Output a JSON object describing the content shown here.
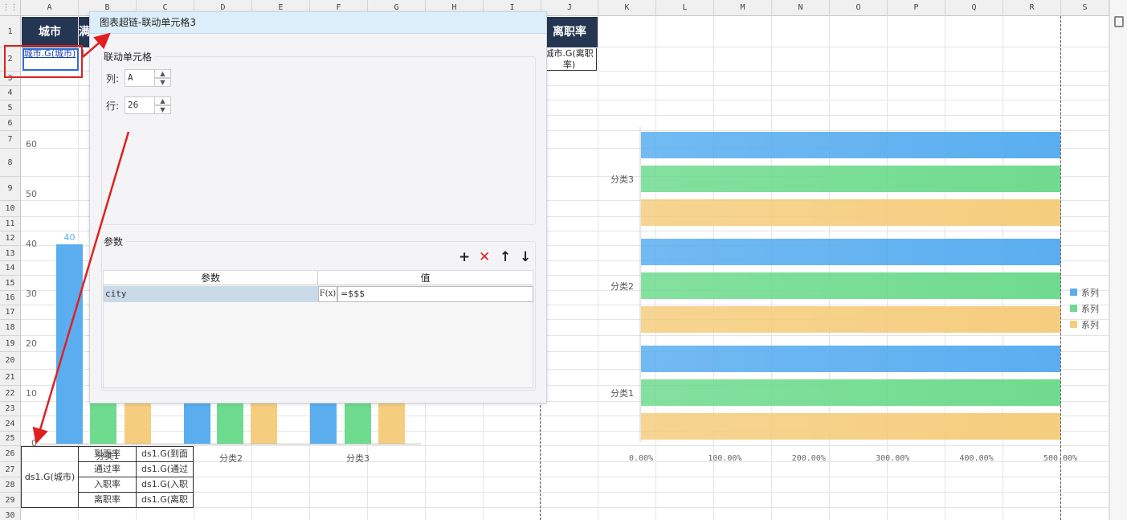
{
  "sheet": {
    "corner": "⋮⋮",
    "columns": [
      "A",
      "B",
      "C",
      "D",
      "E",
      "F",
      "G",
      "H",
      "I",
      "J",
      "K",
      "L",
      "M",
      "N",
      "O",
      "P",
      "Q",
      "R",
      "S"
    ],
    "rows": [
      "1",
      "2",
      "3",
      "4",
      "5",
      "6",
      "7",
      "8",
      "9",
      "10",
      "11",
      "12",
      "13",
      "14",
      "15",
      "16",
      "17",
      "18",
      "19",
      "20",
      "21",
      "22",
      "23",
      "24",
      "25",
      "26",
      "27",
      "28",
      "29",
      "30"
    ],
    "header_city": "城市",
    "header_b_partial": "满",
    "header_leave": "离职率",
    "cell_a2": "城市.G(城市)",
    "cell_j2": "城市.G(离职率)",
    "cell_b2_partial": "1"
  },
  "dialog": {
    "title": "图表超链-联动单元格3",
    "linked_section_title": "联动单元格",
    "col_label": "列:",
    "col_value": "A",
    "row_label": "行:",
    "row_value": "26",
    "param_section_title": "参数",
    "toolbar": {
      "add": "+",
      "delete": "✕",
      "up": "↑",
      "down": "↓"
    },
    "table_headers": {
      "param": "参数",
      "value": "值"
    },
    "rows": [
      {
        "param": "city",
        "fx": "F(x)",
        "value": "=$$$"
      }
    ]
  },
  "left_chart": {
    "y_ticks": [
      "60",
      "50",
      "40",
      "30",
      "20",
      "10",
      "0"
    ],
    "bar_label": "40",
    "categories_visible": [
      "分类2",
      "分类3"
    ]
  },
  "bottom_table": {
    "group": "ds1.G(城市)",
    "labels": [
      "到面率",
      "通过率",
      "入职率",
      "离职率"
    ],
    "label_overlap": "分类1",
    "values": [
      "ds1.G(到面",
      "ds1.G(通过",
      "ds1.G(入职",
      "ds1.G(离职"
    ]
  },
  "chart_data": {
    "type": "bar",
    "orientation": "horizontal",
    "categories": [
      "分类3",
      "分类2",
      "分类1"
    ],
    "x_ticks": [
      "0.00%",
      "100.00%",
      "200.00%",
      "300.00%",
      "400.00%",
      "500.00%"
    ],
    "xlim": [
      0,
      500
    ],
    "series": [
      {
        "name": "系列",
        "values": [
          500,
          500,
          500
        ],
        "color": "#5aaef0"
      },
      {
        "name": "系列",
        "values": [
          500,
          500,
          500
        ],
        "color": "#6fdb8e"
      },
      {
        "name": "系列",
        "values": [
          500,
          500,
          500
        ],
        "color": "#f5cd7e"
      }
    ],
    "legend": "right"
  },
  "colors": {
    "header_bg": "#253653",
    "annotation": "#e02020",
    "blue": "#5aaef0",
    "green": "#6fdb8e",
    "orange": "#f5cd7e"
  }
}
